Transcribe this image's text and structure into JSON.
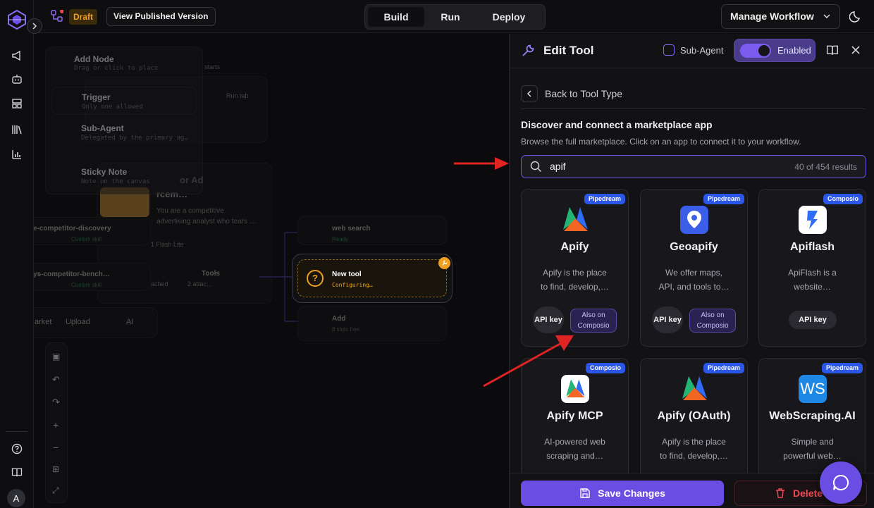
{
  "topbar": {
    "status_badge": "Draft",
    "view_published": "View Published Version",
    "modes": [
      "Build",
      "Run",
      "Deploy"
    ],
    "active_mode": "Build",
    "manage_workflow": "Manage Workflow"
  },
  "user": {
    "avatar_initial": "A"
  },
  "canvas": {
    "add_node": {
      "title": "Add Node",
      "subtitle": "Drag or click to place"
    },
    "trigger": {
      "title": "Trigger",
      "subtitle": "Only one allowed"
    },
    "sub_agent": {
      "title": "Sub-Agent",
      "subtitle": "Delegated by the primary ag…"
    },
    "sticky_note": {
      "title": "Sticky Note",
      "subtitle": "Note on the canvas"
    },
    "behind_text": {
      "starts": "starts",
      "run_tab": "Run tab",
      "agent_title_a": "or Ad",
      "agent_title_b": "rcem…"
    },
    "agent_desc": [
      "You are a competitive",
      "advertising analyst who tears …"
    ],
    "flash_lite": "1 Flash Lite",
    "skill1": {
      "name": "e-competitor-discovery",
      "sub": "Custom skill"
    },
    "skill2": {
      "name": "ys-competitor-bench…",
      "sub": "Custom skill"
    },
    "attached": "ached",
    "tools": {
      "title": "Tools",
      "sub": "2 attac…"
    },
    "web_search": {
      "title": "web search",
      "sub": "Ready"
    },
    "new_tool": {
      "title": "New tool",
      "sub": "Configuring…"
    },
    "add": {
      "title": "Add",
      "sub": "8 slots free"
    },
    "bottom_buttons": [
      "arket",
      "Upload",
      "AI"
    ]
  },
  "panel": {
    "title": "Edit Tool",
    "sub_agent_label": "Sub-Agent",
    "enabled_label": "Enabled",
    "back_label": "Back to Tool Type",
    "discover_title": "Discover and connect a marketplace app",
    "discover_sub": "Browse the full marketplace. Click on an app to connect it to your workflow.",
    "search_value": "apif",
    "results_count": "40 of 454 results",
    "apps": [
      {
        "name": "Apify",
        "badge": "Pipedream",
        "desc": [
          "Apify is the place",
          "to find, develop,…"
        ],
        "tags": [
          "API key",
          "Also on Composio"
        ]
      },
      {
        "name": "Geoapify",
        "badge": "Pipedream",
        "desc": [
          "We offer maps,",
          "API, and tools to…"
        ],
        "tags": [
          "API key",
          "Also on Composio"
        ]
      },
      {
        "name": "Apiflash",
        "badge": "Composio",
        "desc": [
          "ApiFlash is a",
          "website…"
        ],
        "tags": [
          "API key"
        ]
      },
      {
        "name": "Apify MCP",
        "badge": "Composio",
        "desc": [
          "AI-powered web",
          "scraping and…"
        ],
        "tags": []
      },
      {
        "name": "Apify (OAuth)",
        "badge": "Pipedream",
        "desc": [
          "Apify is the place",
          "to find, develop,…"
        ],
        "tags": []
      },
      {
        "name": "WebScraping.AI",
        "badge": "Pipedream",
        "desc": [
          "Simple and",
          "powerful web…"
        ],
        "tags": []
      }
    ],
    "save_label": "Save Changes",
    "delete_label": "Delete"
  },
  "colors": {
    "accent": "#6a4de3",
    "draft": "#f0a020",
    "badge": "#2b56e8",
    "annotation_arrow": "#e02424"
  },
  "icons": [
    "logo-icon",
    "chevron-right-icon",
    "megaphone-icon",
    "bot-icon",
    "layout-icon",
    "library-icon",
    "bar-chart-icon",
    "help-icon",
    "book-icon",
    "nodes-icon",
    "chevron-down-icon",
    "moon-icon",
    "wrench-icon",
    "close-icon",
    "search-icon",
    "save-icon",
    "trash-icon",
    "chat-icon"
  ]
}
